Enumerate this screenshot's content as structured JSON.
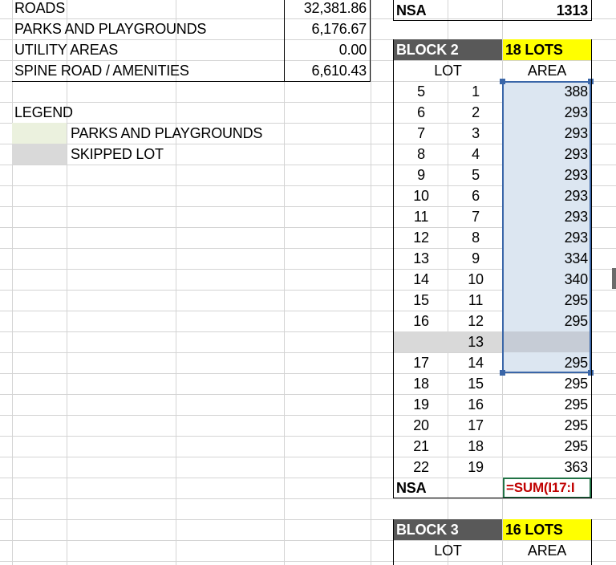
{
  "summary": {
    "rows": [
      {
        "label": "ROADS",
        "value": "32,381.86"
      },
      {
        "label": "PARKS AND PLAYGROUNDS",
        "value": "6,176.67"
      },
      {
        "label": "UTILITY AREAS",
        "value": "0.00"
      },
      {
        "label": "SPINE ROAD / AMENITIES",
        "value": "6,610.43"
      }
    ]
  },
  "legend": {
    "title": "LEGEND",
    "items": [
      {
        "label": "PARKS AND PLAYGROUNDS",
        "color": "#ebf1de"
      },
      {
        "label": "SKIPPED LOT",
        "color": "#d9d9d9"
      }
    ]
  },
  "top_nsa": {
    "label": "NSA",
    "value": "1313"
  },
  "block2": {
    "title": "BLOCK 2",
    "lots_badge": "18 LOTS",
    "col_lot": "LOT",
    "col_area": "AREA",
    "rows": [
      {
        "n": "5",
        "lot": "1",
        "area": "388"
      },
      {
        "n": "6",
        "lot": "2",
        "area": "293"
      },
      {
        "n": "7",
        "lot": "3",
        "area": "293"
      },
      {
        "n": "8",
        "lot": "4",
        "area": "293"
      },
      {
        "n": "9",
        "lot": "5",
        "area": "293"
      },
      {
        "n": "10",
        "lot": "6",
        "area": "293"
      },
      {
        "n": "11",
        "lot": "7",
        "area": "293"
      },
      {
        "n": "12",
        "lot": "8",
        "area": "293"
      },
      {
        "n": "13",
        "lot": "9",
        "area": "334"
      },
      {
        "n": "14",
        "lot": "10",
        "area": "340"
      },
      {
        "n": "15",
        "lot": "11",
        "area": "295"
      },
      {
        "n": "16",
        "lot": "12",
        "area": "295"
      },
      {
        "n": "",
        "lot": "13",
        "area": "",
        "skipped": true
      },
      {
        "n": "17",
        "lot": "14",
        "area": "295"
      },
      {
        "n": "18",
        "lot": "15",
        "area": "295"
      },
      {
        "n": "19",
        "lot": "16",
        "area": "295"
      },
      {
        "n": "20",
        "lot": "17",
        "area": "295"
      },
      {
        "n": "21",
        "lot": "18",
        "area": "295"
      },
      {
        "n": "22",
        "lot": "19",
        "area": "363"
      }
    ],
    "nsa_label": "NSA",
    "formula": "=SUM(I17:I"
  },
  "block3": {
    "title": "BLOCK 3",
    "lots_badge": "16 LOTS",
    "col_lot": "LOT",
    "col_area": "AREA"
  },
  "colors": {
    "selection_fill": "#dce6f1",
    "selection_border": "#3a66a8",
    "formula_text": "#c00000",
    "active_cell_border": "#217346"
  }
}
